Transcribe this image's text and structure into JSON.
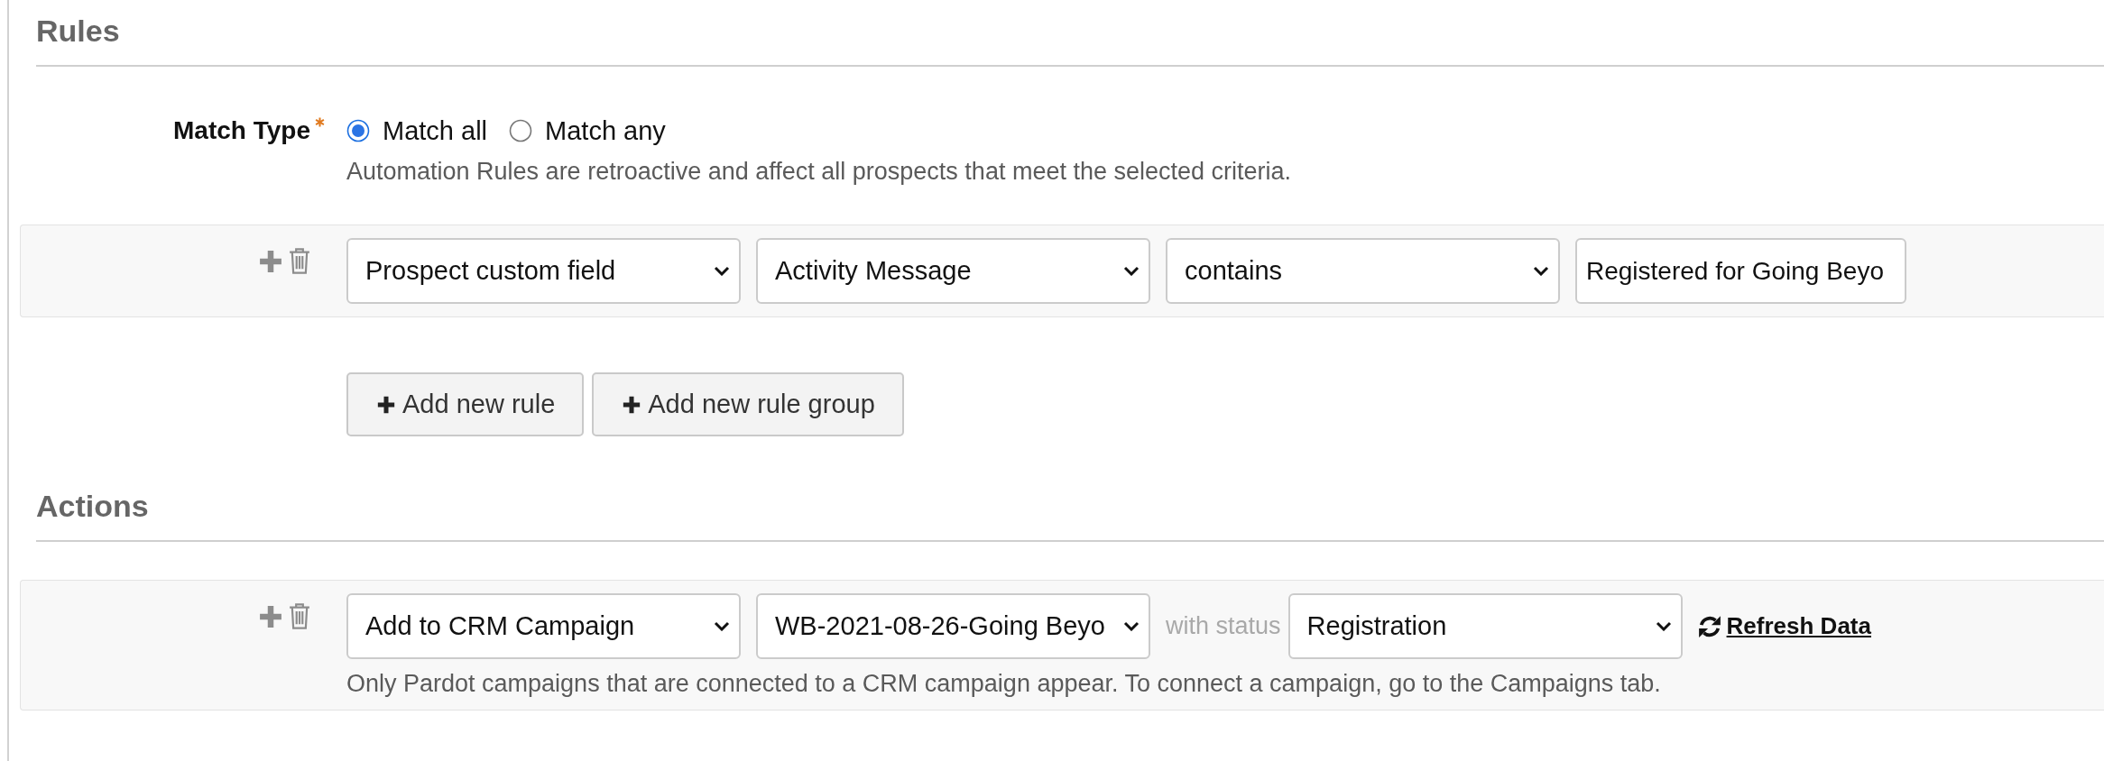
{
  "rules_section": {
    "title": "Rules",
    "match_type": {
      "label": "Match Type",
      "required": true,
      "options": [
        {
          "label": "Match all",
          "selected": true
        },
        {
          "label": "Match any",
          "selected": false
        }
      ],
      "help": "Automation Rules are retroactive and affect all prospects that meet the selected criteria."
    },
    "rules": [
      {
        "fields": [
          {
            "kind": "select",
            "value": "Prospect custom field"
          },
          {
            "kind": "select",
            "value": "Activity Message"
          },
          {
            "kind": "select",
            "value": "contains"
          },
          {
            "kind": "text_input",
            "value": "Registered for Going Beyo"
          }
        ]
      }
    ],
    "buttons": [
      "Add new rule",
      "Add new rule group"
    ]
  },
  "actions_section": {
    "title": "Actions",
    "actions": [
      {
        "fields": [
          {
            "kind": "select",
            "value": "Add to CRM Campaign"
          },
          {
            "kind": "select",
            "value": "WB-2021-08-26-Going Beyo"
          },
          {
            "kind": "label",
            "value": "with status"
          },
          {
            "kind": "select",
            "value": "Registration"
          },
          {
            "kind": "link",
            "value": "Refresh Data"
          }
        ],
        "help": "Only Pardot campaigns that are connected to a CRM campaign appear. To connect a campaign, go to the Campaigns tab."
      }
    ]
  }
}
